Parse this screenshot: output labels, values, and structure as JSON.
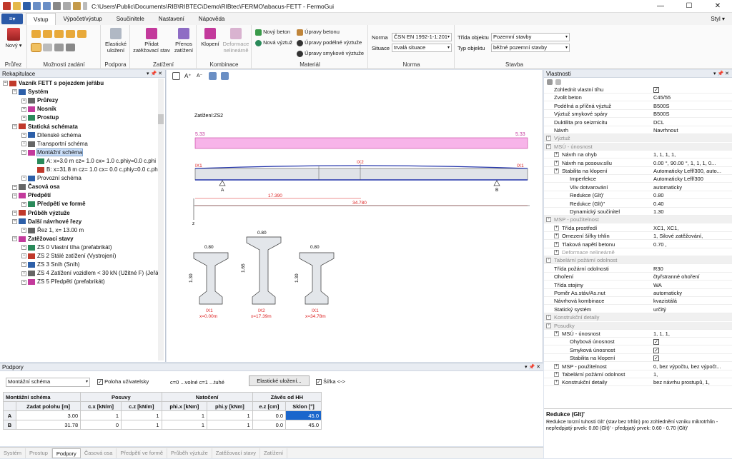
{
  "window": {
    "title": "C:\\Users\\Public\\Documents\\RIB\\RIBTEC\\Demo\\RIBtec\\FERMO\\abacus-FETT - FermoGui"
  },
  "ribbon_tabs": [
    "Vstup",
    "Výpočet/výstup",
    "Součinitele",
    "Nastavení",
    "Nápověda"
  ],
  "style_label": "Styl",
  "ribbon": {
    "pruzez": {
      "label": "Průřez",
      "new_label": "Nový"
    },
    "moznosti": {
      "label": "Možnosti zadání"
    },
    "podpora": {
      "label": "Podpora",
      "elasticke": "Elastické uložení"
    },
    "zatizeni": {
      "label": "Zatížení",
      "pridat": "Přidat zatěžovací stav",
      "prenos": "Přenos zatížení"
    },
    "kombinace": {
      "label": "Kombinace",
      "klopeni": "Klopení",
      "deformace": "Deformace nelineárně"
    },
    "material": {
      "label": "Materiál",
      "novy_beton": "Nový beton",
      "nova_vyztuz": "Nová výztuž",
      "upravy_betonu": "Úpravy betonu",
      "upravy_podelne": "Úpravy podélné výztuže",
      "upravy_smykove": "Úpravy smykové výztuže"
    },
    "norma": {
      "label": "Norma",
      "norma_label": "Norma",
      "norma_value": "ČSN EN 1992-1-1:201",
      "situace_label": "Situace",
      "situace_value": "trvalá situace"
    },
    "stavba": {
      "label": "Stavba",
      "trida_label": "Třída objektu",
      "trida_value": "Pozemní stavby",
      "typ_label": "Typ objektu",
      "typ_value": "běžné pozemní stavby"
    }
  },
  "left": {
    "title": "Rekapitulace",
    "tree": [
      {
        "label": "Vazník FETT s pojezdem jeřábu",
        "bold": true,
        "level": 0
      },
      {
        "label": "Systém",
        "bold": true,
        "level": 1
      },
      {
        "label": "Průřezy",
        "bold": true,
        "level": 2
      },
      {
        "label": "Nosník",
        "bold": true,
        "level": 2
      },
      {
        "label": "Prostup",
        "bold": true,
        "level": 2
      },
      {
        "label": "Statická schémata",
        "bold": true,
        "level": 1
      },
      {
        "label": "Dílenské schéma",
        "bold": false,
        "level": 2
      },
      {
        "label": "Transportní schéma",
        "bold": false,
        "level": 2
      },
      {
        "label": "Montážní schéma",
        "bold": false,
        "level": 2,
        "selected": true
      },
      {
        "label": "A: x=3.0 m  cz= 1.0 cx= 1.0 c.phiy=0.0 c.phi",
        "bold": false,
        "level": 3
      },
      {
        "label": "B: x=31.8 m  cz= 1.0 cx= 0.0 c.phiy=0.0 c.phi",
        "bold": false,
        "level": 3
      },
      {
        "label": "Provozní schéma",
        "bold": false,
        "level": 2
      },
      {
        "label": "Časová osa",
        "bold": true,
        "level": 1
      },
      {
        "label": "Předpětí",
        "bold": true,
        "level": 1
      },
      {
        "label": "Předpětí ve formě",
        "bold": true,
        "level": 2
      },
      {
        "label": "Průběh výztuže",
        "bold": true,
        "level": 1
      },
      {
        "label": "Další návrhové řezy",
        "bold": true,
        "level": 1
      },
      {
        "label": "Řez 1, x= 13.00 m",
        "bold": false,
        "level": 2
      },
      {
        "label": "Zatěžovací stavy",
        "bold": true,
        "level": 1
      },
      {
        "label": "ZS 0 Vlastní tíha (prefabrikát)",
        "bold": false,
        "level": 2
      },
      {
        "label": "ZS 2 Stálé zatížení (Vystrojení)",
        "bold": false,
        "level": 2
      },
      {
        "label": "ZS 3 Sníh (Sníh)",
        "bold": false,
        "level": 2
      },
      {
        "label": "ZS 4 Zatížení vozidlem < 30 kN (Užitné F) (Jeřá",
        "bold": false,
        "level": 2
      },
      {
        "label": "ZS 5 Předpětí (prefabrikát)",
        "bold": false,
        "level": 2
      }
    ]
  },
  "canvas": {
    "load_label": "Zatížení:ZS2",
    "load_left": "5.33",
    "load_right": "5.33",
    "ix_left": "IX1",
    "ix_mid": "IX2",
    "ix_right": "IX1",
    "support_a": "A",
    "support_b": "B",
    "dim1": "17.390",
    "dim2": "34.780",
    "z_label": "z",
    "sections": [
      {
        "width": "0.80",
        "height": "1.30",
        "name": "IX1",
        "pos": "x=0.00m"
      },
      {
        "width": "0.80",
        "height": "1.65",
        "name": "IX2",
        "pos": "x=17.39m"
      },
      {
        "width": "0.80",
        "height": "1.30",
        "name": "IX1",
        "pos": "x=34.78m"
      }
    ]
  },
  "bottom": {
    "title": "Podpory",
    "combo_value": "Montážní schéma",
    "chk_label": "Poloha uživatelsky",
    "hint": "c=0 ...volné   c=1 ...tuhé",
    "btn_elastic": "Elastické uložení...",
    "chk_sirka": "Šířka <->",
    "grp_headers": [
      "Montážní schéma",
      "Posuvy",
      "Natočení",
      "Závěs od HH"
    ],
    "headers": [
      "Zadat polohu [m]",
      "c.x [kN/m]",
      "c.z [kN/m]",
      "phi.x [kNm]",
      "phi.y [kNm]",
      "e.z [cm]",
      "Sklon [°]"
    ],
    "rows": [
      {
        "id": "A",
        "vals": [
          "3.00",
          "1",
          "1",
          "1",
          "1",
          "0.0",
          "45.0"
        ]
      },
      {
        "id": "B",
        "vals": [
          "31.78",
          "0",
          "1",
          "1",
          "1",
          "0.0",
          "45.0"
        ]
      }
    ]
  },
  "status_tabs": [
    "Systém",
    "Prostup",
    "Podpory",
    "Časová osa",
    "Předpětí ve formě",
    "Průběh výztuže",
    "Zatěžovací stavy",
    "Zatížení"
  ],
  "right": {
    "title": "Vlastnosti",
    "rows": [
      {
        "k": "Zohlednit vlastní tíhu",
        "v": "",
        "chk": true,
        "indent": 1
      },
      {
        "k": "Zvolit beton",
        "v": "C45/55",
        "indent": 1
      },
      {
        "k": "Podélná a příčná výztuž",
        "v": "B500S",
        "indent": 1
      },
      {
        "k": "Výztuž smykové spáry",
        "v": "B500S",
        "indent": 1
      },
      {
        "k": "Duktilita pro seizmicitu",
        "v": "DCL",
        "indent": 1
      },
      {
        "k": "Návrh",
        "v": "Navrhnout",
        "indent": 1
      },
      {
        "k": "Výztuž",
        "v": "",
        "cat": true
      },
      {
        "k": "MSÚ - únosnost",
        "v": "",
        "cat": true
      },
      {
        "k": "Návrh na ohyb",
        "v": "1, 1, 1, 1,",
        "indent": 2
      },
      {
        "k": "Návrh na posouv.sílu",
        "v": "0.00 °, 90.00 °, 1, 1, 1, 0...",
        "indent": 2
      },
      {
        "k": "Stabilita na klopení",
        "v": "Automaticky Leff/300, auto...",
        "indent": 2
      },
      {
        "k": "Imperfekce",
        "v": "Automaticky Leff/300",
        "indent": 3
      },
      {
        "k": "Vliv dotvarování",
        "v": "automaticky",
        "indent": 3
      },
      {
        "k": "Redukce (Glt)'",
        "v": "0.80",
        "indent": 3
      },
      {
        "k": "Redukce (Glt)''",
        "v": "0.40",
        "indent": 3
      },
      {
        "k": "Dynamický součinitel",
        "v": "1.30",
        "indent": 3
      },
      {
        "k": "MSP - použitelnost",
        "v": "",
        "cat": true
      },
      {
        "k": "Třída prostředí",
        "v": "XC1, XC1,",
        "indent": 2
      },
      {
        "k": "Omezení šířky trhlin",
        "v": "1, Silové zatěžování,",
        "indent": 2
      },
      {
        "k": "Tlaková napětí betonu",
        "v": "0.70 ,",
        "indent": 2
      },
      {
        "k": "Deformace nelineárně",
        "v": "",
        "indent": 2,
        "grey": true
      },
      {
        "k": "Tabelární požární odolnost",
        "v": "",
        "cat": true
      },
      {
        "k": "Třída požární odolnosti",
        "v": "R30",
        "indent": 1
      },
      {
        "k": "Ohoření",
        "v": "čtyřstranné ohoření",
        "indent": 1
      },
      {
        "k": "Třída stojiny",
        "v": "WA",
        "indent": 1
      },
      {
        "k": "Poměr As.stáv/As.nut",
        "v": "automaticky",
        "indent": 1
      },
      {
        "k": "Návrhová kombinace",
        "v": "kvazistálá",
        "indent": 1
      },
      {
        "k": "Statický systém",
        "v": "určitý",
        "indent": 1
      },
      {
        "k": "Konstrukční detaily",
        "v": "",
        "cat": true
      },
      {
        "k": "Posudky",
        "v": "",
        "cat": true
      },
      {
        "k": "MSÚ - únosnost",
        "v": "1, 1, 1,",
        "indent": 2
      },
      {
        "k": "Ohybová únosnost",
        "v": "",
        "chk": true,
        "indent": 3
      },
      {
        "k": "Smyková únosnost",
        "v": "",
        "chk": true,
        "indent": 3
      },
      {
        "k": "Stabilita na klopení",
        "v": "",
        "chk": true,
        "indent": 3
      },
      {
        "k": "MSP - použitelnost",
        "v": "0, bez výpočtu, bez výpočt...",
        "indent": 2
      },
      {
        "k": "Tabelární požární odolnost",
        "v": "1,",
        "indent": 2
      },
      {
        "k": "Konstrukční detaily",
        "v": "bez návrhu prostupů, 1,",
        "indent": 2
      }
    ],
    "desc_title": "Redukce (Glt)'",
    "desc_text": "Redukce torzní tuhosti Glt' (stav bez trhlin) pro zohlednění vzniku mikrotrhlin - nepředpjatý prvek: 0.80 (Glt)' - předpjatý prvek: 0.60 - 0.70 (Glt)'"
  }
}
